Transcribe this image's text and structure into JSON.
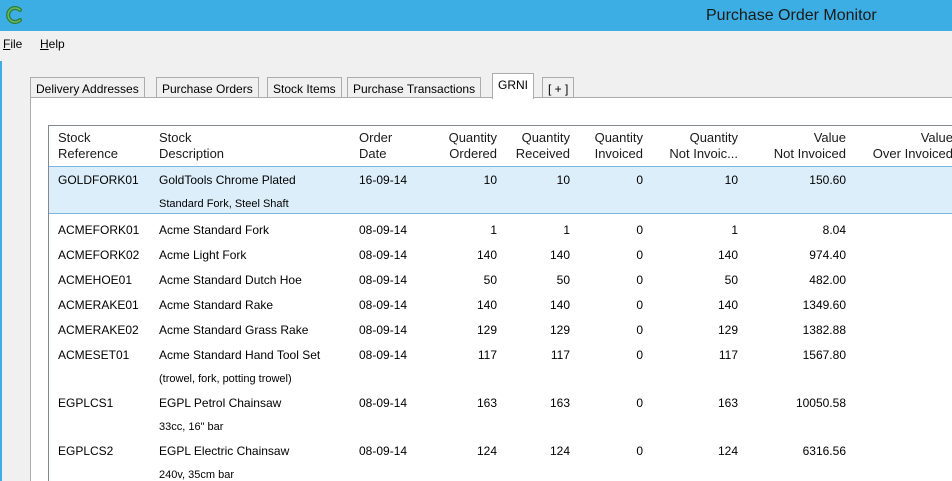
{
  "window": {
    "title": "Purchase Order Monitor",
    "icon": "app-c-icon",
    "accent": "#3daee3"
  },
  "menu": [
    {
      "label": "File",
      "accel": "F",
      "rest": "ile"
    },
    {
      "label": "Help",
      "accel": "H",
      "rest": "elp"
    }
  ],
  "tabs": [
    {
      "label": "Delivery Addresses"
    },
    {
      "label": "Purchase Orders"
    },
    {
      "label": "Stock Items"
    },
    {
      "label": "Purchase Transactions"
    },
    {
      "label": "GRNI",
      "active": true
    },
    {
      "label": "[ + ]"
    }
  ],
  "grid": {
    "columns": [
      {
        "line1": "Stock",
        "line2": "Reference"
      },
      {
        "line1": "Stock",
        "line2": "Description"
      },
      {
        "line1": "Order",
        "line2": "Date"
      },
      {
        "line1": "Quantity",
        "line2": "Ordered"
      },
      {
        "line1": "Quantity",
        "line2": "Received"
      },
      {
        "line1": "Quantity",
        "line2": "Invoiced"
      },
      {
        "line1": "Quantity",
        "line2": "Not Invoic..."
      },
      {
        "line1": "Value",
        "line2": "Not Invoiced"
      },
      {
        "line1": "Value",
        "line2": "Over Invoiced"
      }
    ],
    "rows": [
      {
        "ref": "GOLDFORK01",
        "desc1": "GoldTools Chrome Plated",
        "desc2": "Standard Fork, Steel Shaft",
        "date": "16-09-14",
        "ordered": "10",
        "received": "10",
        "invoiced": "0",
        "notinv": "10",
        "value": "150.60",
        "selected": true
      },
      {
        "ref": "ACMEFORK01",
        "desc1": "Acme Standard Fork",
        "desc2": "",
        "date": "08-09-14",
        "ordered": "1",
        "received": "1",
        "invoiced": "0",
        "notinv": "1",
        "value": "8.04"
      },
      {
        "ref": "ACMEFORK02",
        "desc1": "Acme Light Fork",
        "desc2": "",
        "date": "08-09-14",
        "ordered": "140",
        "received": "140",
        "invoiced": "0",
        "notinv": "140",
        "value": "974.40"
      },
      {
        "ref": "ACMEHOE01",
        "desc1": "Acme Standard Dutch Hoe",
        "desc2": "",
        "date": "08-09-14",
        "ordered": "50",
        "received": "50",
        "invoiced": "0",
        "notinv": "50",
        "value": "482.00"
      },
      {
        "ref": "ACMERAKE01",
        "desc1": "Acme Standard Rake",
        "desc2": "",
        "date": "08-09-14",
        "ordered": "140",
        "received": "140",
        "invoiced": "0",
        "notinv": "140",
        "value": "1349.60"
      },
      {
        "ref": "ACMERAKE02",
        "desc1": "Acme Standard Grass Rake",
        "desc2": "",
        "date": "08-09-14",
        "ordered": "129",
        "received": "129",
        "invoiced": "0",
        "notinv": "129",
        "value": "1382.88"
      },
      {
        "ref": "ACMESET01",
        "desc1": "Acme Standard Hand Tool Set",
        "desc2": "(trowel, fork, potting trowel)",
        "date": "08-09-14",
        "ordered": "117",
        "received": "117",
        "invoiced": "0",
        "notinv": "117",
        "value": "1567.80"
      },
      {
        "ref": "EGPLCS1",
        "desc1": "EGPL Petrol Chainsaw",
        "desc2": "33cc, 16\" bar",
        "date": "08-09-14",
        "ordered": "163",
        "received": "163",
        "invoiced": "0",
        "notinv": "163",
        "value": "10050.58"
      },
      {
        "ref": "EGPLCS2",
        "desc1": "EGPL Electric Chainsaw",
        "desc2": "240v, 35cm bar",
        "date": "08-09-14",
        "ordered": "124",
        "received": "124",
        "invoiced": "0",
        "notinv": "124",
        "value": "6316.56"
      }
    ]
  }
}
